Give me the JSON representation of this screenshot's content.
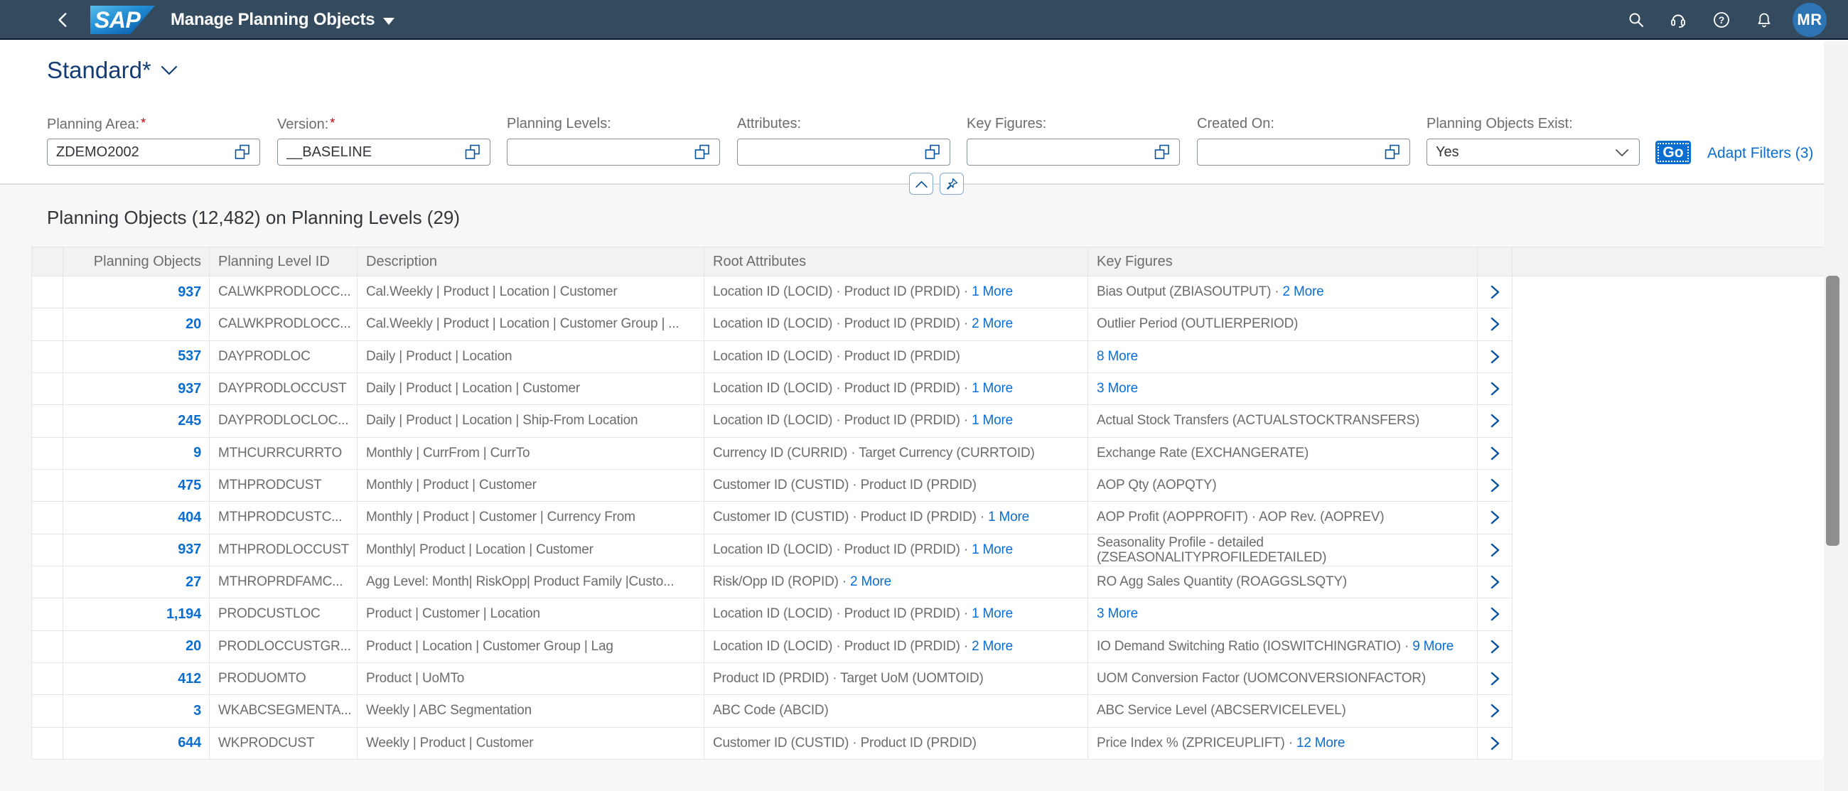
{
  "shell": {
    "logo_text": "SAP",
    "title": "Manage Planning Objects",
    "avatar_initials": "MR"
  },
  "variant": {
    "name": "Standard*"
  },
  "filterbar": {
    "fields": [
      {
        "label": "Planning Area:",
        "required": true,
        "value": "ZDEMO2002"
      },
      {
        "label": "Version:",
        "required": true,
        "value": "__BASELINE"
      },
      {
        "label": "Planning Levels:",
        "required": false,
        "value": ""
      },
      {
        "label": "Attributes:",
        "required": false,
        "value": ""
      },
      {
        "label": "Key Figures:",
        "required": false,
        "value": ""
      },
      {
        "label": "Created On:",
        "required": false,
        "value": ""
      }
    ],
    "exists_filter": {
      "label": "Planning Objects Exist:",
      "value": "Yes"
    },
    "go_label": "Go",
    "adapt_filters_label": "Adapt Filters (3)"
  },
  "table": {
    "title": "Planning Objects (12,482) on Planning Levels (29)",
    "columns": [
      "Planning Objects",
      "Planning Level ID",
      "Description",
      "Root Attributes",
      "Key Figures"
    ],
    "rows": [
      {
        "count": "937",
        "level_id": "CALWKPRODLOCC...",
        "description": "Cal.Weekly | Product | Location | Customer",
        "root": "Location ID (LOCID) · Product ID (PRDID)",
        "root_more": "1 More",
        "kf": "Bias Output (ZBIASOUTPUT)",
        "kf_more": "2 More"
      },
      {
        "count": "20",
        "level_id": "CALWKPRODLOCC...",
        "description": "Cal.Weekly | Product | Location | Customer Group | ...",
        "root": "Location ID (LOCID) · Product ID (PRDID)",
        "root_more": "2 More",
        "kf": "Outlier Period (OUTLIERPERIOD)",
        "kf_more": ""
      },
      {
        "count": "537",
        "level_id": "DAYPRODLOC",
        "description": "Daily | Product | Location",
        "root": "Location ID (LOCID) · Product ID (PRDID)",
        "root_more": "",
        "kf": "",
        "kf_more": "8 More"
      },
      {
        "count": "937",
        "level_id": "DAYPRODLOCCUST",
        "description": "Daily | Product | Location | Customer",
        "root": "Location ID (LOCID) · Product ID (PRDID)",
        "root_more": "1 More",
        "kf": "",
        "kf_more": "3 More"
      },
      {
        "count": "245",
        "level_id": "DAYPRODLOCLOC...",
        "description": "Daily | Product | Location | Ship-From Location",
        "root": "Location ID (LOCID) · Product ID (PRDID)",
        "root_more": "1 More",
        "kf": "Actual Stock Transfers (ACTUALSTOCKTRANSFERS)",
        "kf_more": ""
      },
      {
        "count": "9",
        "level_id": "MTHCURRCURRTO",
        "description": "Monthly | CurrFrom | CurrTo",
        "root": "Currency ID (CURRID) · Target Currency (CURRTOID)",
        "root_more": "",
        "kf": "Exchange Rate (EXCHANGERATE)",
        "kf_more": ""
      },
      {
        "count": "475",
        "level_id": "MTHPRODCUST",
        "description": "Monthly | Product | Customer",
        "root": "Customer ID (CUSTID) · Product ID (PRDID)",
        "root_more": "",
        "kf": "AOP Qty (AOPQTY)",
        "kf_more": ""
      },
      {
        "count": "404",
        "level_id": "MTHPRODCUSTC...",
        "description": "Monthly | Product | Customer | Currency From",
        "root": "Customer ID (CUSTID) · Product ID (PRDID)",
        "root_more": "1 More",
        "kf": "AOP Profit (AOPPROFIT) · AOP Rev. (AOPREV)",
        "kf_more": ""
      },
      {
        "count": "937",
        "level_id": "MTHPRODLOCCUST",
        "description": "Monthly| Product | Location | Customer",
        "root": "Location ID (LOCID) · Product ID (PRDID)",
        "root_more": "1 More",
        "kf": "Seasonality Profile - detailed (ZSEASONALITYPROFILEDETAILED)",
        "kf_more": "",
        "kf_twoline": true
      },
      {
        "count": "27",
        "level_id": "MTHROPRDFAMC...",
        "description": "Agg Level: Month| RiskOpp| Product Family |Custo...",
        "root": "Risk/Opp ID (ROPID)",
        "root_more": "2 More",
        "kf": "RO Agg Sales Quantity (ROAGGSLSQTY)",
        "kf_more": ""
      },
      {
        "count": "1,194",
        "level_id": "PRODCUSTLOC",
        "description": "Product | Customer | Location",
        "root": "Location ID (LOCID) · Product ID (PRDID)",
        "root_more": "1 More",
        "kf": "",
        "kf_more": "3 More"
      },
      {
        "count": "20",
        "level_id": "PRODLOCCUSTGR...",
        "description": "Product | Location | Customer Group | Lag",
        "root": "Location ID (LOCID) · Product ID (PRDID)",
        "root_more": "2 More",
        "kf": "IO Demand Switching Ratio (IOSWITCHINGRATIO)",
        "kf_more": "9 More"
      },
      {
        "count": "412",
        "level_id": "PRODUOMTO",
        "description": "Product | UoMTo",
        "root": "Product ID (PRDID) · Target UoM (UOMTOID)",
        "root_more": "",
        "kf": "UOM Conversion Factor (UOMCONVERSIONFACTOR)",
        "kf_more": ""
      },
      {
        "count": "3",
        "level_id": "WKABCSEGMENTA...",
        "description": "Weekly | ABC Segmentation",
        "root": "ABC Code (ABCID)",
        "root_more": "",
        "kf": "ABC Service Level (ABCSERVICELEVEL)",
        "kf_more": ""
      },
      {
        "count": "644",
        "level_id": "WKPRODCUST",
        "description": "Weekly | Product | Customer",
        "root": "Customer ID (CUSTID) · Product ID (PRDID)",
        "root_more": "",
        "kf": "Price Index % (ZPRICEUPLIFT)",
        "kf_more": "12 More"
      }
    ]
  }
}
